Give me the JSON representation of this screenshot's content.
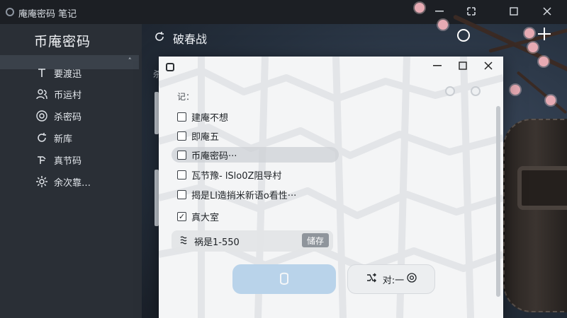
{
  "app": {
    "title": "庵庵密码 笔记",
    "window_buttons": [
      "minimize",
      "pin",
      "maximize",
      "close"
    ]
  },
  "sidebar": {
    "heading": "币庵密码",
    "items": [
      {
        "label": "要渡迅",
        "icon": "text-cursor-icon"
      },
      {
        "label": "币运村",
        "icon": "people-icon"
      },
      {
        "label": "杀密码",
        "icon": "target-icon"
      },
      {
        "label": "新库",
        "icon": "refresh-icon"
      },
      {
        "label": "真节码",
        "icon": "tree-icon"
      },
      {
        "label": "余次靠…",
        "icon": "gear-icon"
      }
    ]
  },
  "main": {
    "heading": "破春战",
    "heading_icon": "refresh-icon",
    "side_glyph": "杀"
  },
  "dialog": {
    "label": "记：",
    "options": [
      {
        "label": "建庵不想",
        "checked": false
      },
      {
        "label": "即庵五",
        "checked": false
      },
      {
        "label": "币庵密码···",
        "checked": false,
        "selected": true
      },
      {
        "label": "瓦节豫- lSlo0Z阻导村",
        "checked": false
      },
      {
        "label": "揭是Ll造捎米新语o看性···",
        "checked": false
      },
      {
        "label": "真大室",
        "checked": true
      }
    ],
    "range": {
      "label": "祸是1-550",
      "button": "储存",
      "icon": "wave-icon"
    },
    "primary_button": {
      "icon": "shield-icon"
    },
    "secondary_button": {
      "label": "对:一",
      "icon": "shuffle-icon",
      "trailing_icon": "target-icon"
    }
  },
  "colors": {
    "sidebar_bg": "#2a2f36",
    "dialog_bg": "#f4f5f6",
    "primary_button": "#b9d3ea",
    "blossom": "#e6aab3"
  }
}
